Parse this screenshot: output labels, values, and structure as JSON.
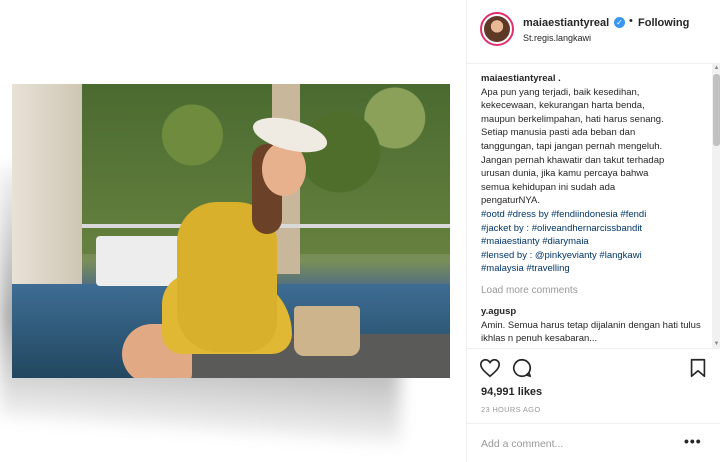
{
  "post": {
    "username": "maiaestiantyreal",
    "verified_glyph": "✓",
    "separator": "•",
    "follow_status": "Following",
    "location": "St.regis.langkawi",
    "caption": {
      "username": "maiaestiantyreal .",
      "text": "Apa pun yang terjadi, baik kesedihan,\nkekecewaan, kekurangan harta benda,\nmaupun berkelimpahan, hati harus senang.\nSetiap manusia pasti ada beban dan\ntanggungan, tapi jangan pernah mengeluh.\nJangan pernah khawatir dan takut terhadap\nurusan dunia, jika kamu percaya bahwa\nsemua kehidupan ini sudah ada\npengaturNYA.",
      "tags": "#ootd #dress by #fendiindonesia #fendi\n#jacket by : #oliveandhernarcissbandit\n#maiaestianty #diarymaia\n#lensed by : @pinkyevianty #langkawi\n#malaysia #travelling"
    },
    "load_more": "Load more comments",
    "comments": [
      {
        "username": "y.agusp",
        "text": "Amin. Semua harus tetap dijalanin dengan hati tulus ikhlas n penuh kesabaran..."
      }
    ],
    "likes": "94,991 likes",
    "timestamp": "23 HOURS AGO",
    "comment_placeholder": "Add a comment...",
    "more_options": "•••"
  },
  "icons": {
    "like": "heart-icon",
    "comment": "comment-bubble-icon",
    "save": "bookmark-icon",
    "verified": "verified-badge-icon",
    "more": "more-options-icon"
  },
  "colors": {
    "text": "#262626",
    "secondary": "#999999",
    "hashtag": "#003569",
    "verified": "#3897f0",
    "story_ring": "#e1306c",
    "divider": "#efefef"
  }
}
